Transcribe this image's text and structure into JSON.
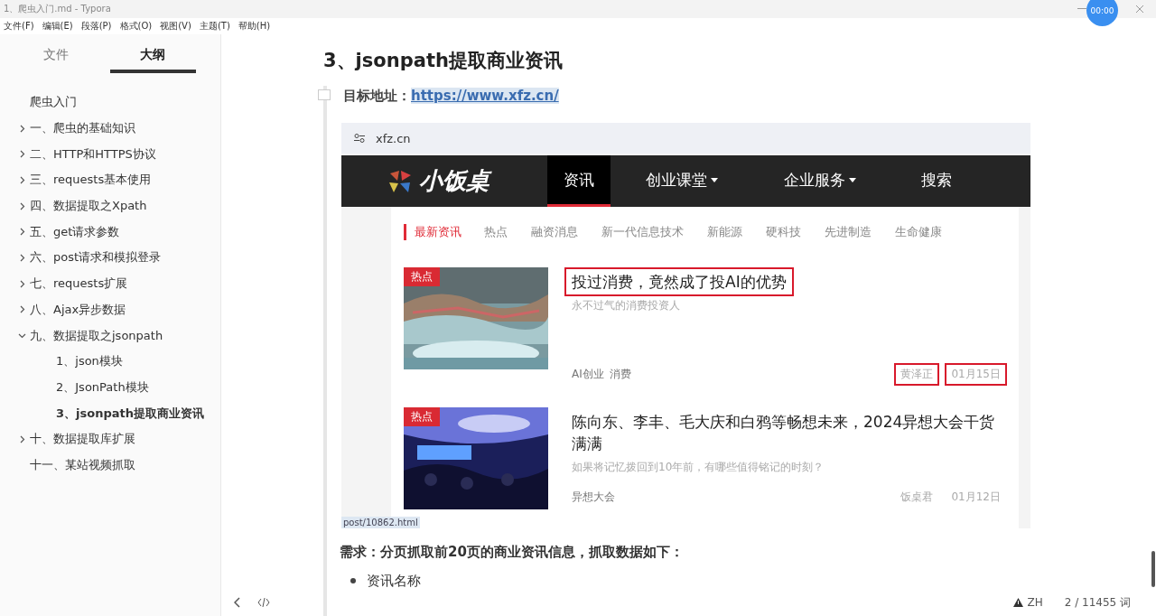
{
  "window": {
    "title": "1、爬虫入门.md - Typora",
    "timer": "00:00"
  },
  "menu": [
    "文件(F)",
    "编辑(E)",
    "段落(P)",
    "格式(O)",
    "视图(V)",
    "主题(T)",
    "帮助(H)"
  ],
  "sidebar": {
    "tabs": [
      {
        "label": "文件",
        "selected": false
      },
      {
        "label": "大纲",
        "selected": true
      }
    ],
    "outline": [
      {
        "label": "爬虫入门",
        "selected": false,
        "children": [
          {
            "label": "一、爬虫的基础知识",
            "expanded": false,
            "selected": false
          },
          {
            "label": "二、HTTP和HTTPS协议",
            "expanded": false,
            "selected": false
          },
          {
            "label": "三、requests基本使用",
            "expanded": false,
            "selected": false
          },
          {
            "label": "四、数据提取之Xpath",
            "expanded": false,
            "selected": false
          },
          {
            "label": "五、get请求参数",
            "expanded": false,
            "selected": false
          },
          {
            "label": "六、post请求和模拟登录",
            "expanded": false,
            "selected": false
          },
          {
            "label": "七、requests扩展",
            "expanded": false,
            "selected": false
          },
          {
            "label": "八、Ajax异步数据",
            "expanded": false,
            "selected": false
          },
          {
            "label": "九、数据提取之jsonpath",
            "expanded": true,
            "selected": false,
            "children": [
              {
                "label": "1、json模块",
                "selected": false
              },
              {
                "label": "2、JsonPath模块",
                "selected": false
              },
              {
                "label": "3、jsonpath提取商业资讯",
                "selected": true
              }
            ]
          },
          {
            "label": "十、数据提取库扩展",
            "expanded": false,
            "selected": false
          },
          {
            "label": "十一、某站视频抓取",
            "selected": false
          }
        ]
      }
    ]
  },
  "document": {
    "heading": "3、jsonpath提取商业资讯",
    "target_label": "目标地址：",
    "target_link": "https://www.xfz.cn/",
    "screenshot": {
      "address": "xfz.cn",
      "logo": "小饭桌",
      "nav": [
        {
          "label": "资讯",
          "selected": true,
          "dropdown": false
        },
        {
          "label": "创业课堂",
          "selected": false,
          "dropdown": true
        },
        {
          "label": "企业服务",
          "selected": false,
          "dropdown": true
        },
        {
          "label": "搜索",
          "selected": false,
          "dropdown": false
        }
      ],
      "categories": [
        {
          "label": "最新资讯",
          "selected": true
        },
        {
          "label": "热点",
          "selected": false
        },
        {
          "label": "融资消息",
          "selected": false
        },
        {
          "label": "新一代信息技术",
          "selected": false
        },
        {
          "label": "新能源",
          "selected": false
        },
        {
          "label": "硬科技",
          "selected": false
        },
        {
          "label": "先进制造",
          "selected": false
        },
        {
          "label": "生命健康",
          "selected": false
        }
      ],
      "articles": [
        {
          "badge": "热点",
          "title": {
            "text": "投过消费，竟然成了投AI的优势",
            "highlighted": true
          },
          "summary": "永不过气的消费投资人",
          "tags": [
            "AI创业",
            "消费"
          ],
          "author": {
            "text": "黄泽正",
            "highlighted": true
          },
          "date": {
            "text": "01月15日",
            "highlighted": true
          }
        },
        {
          "badge": "热点",
          "title": {
            "text": "陈向东、李丰、毛大庆和白鸦等畅想未来，2024异想大会干货满满",
            "highlighted": false
          },
          "summary": "如果将记忆拨回到10年前，有哪些值得铭记的时刻？",
          "tags": [
            "异想大会"
          ],
          "author": {
            "text": "饭桌君",
            "highlighted": false
          },
          "date": {
            "text": "01月12日",
            "highlighted": false
          }
        }
      ],
      "link_tooltip": "post/10862.html"
    },
    "requirement": "需求：分页抓取前20页的商业资讯信息，抓取数据如下：",
    "bullets": [
      "资讯名称"
    ]
  },
  "status_bar": {
    "language": "ZH",
    "word_count": "2 / 11455 词"
  }
}
